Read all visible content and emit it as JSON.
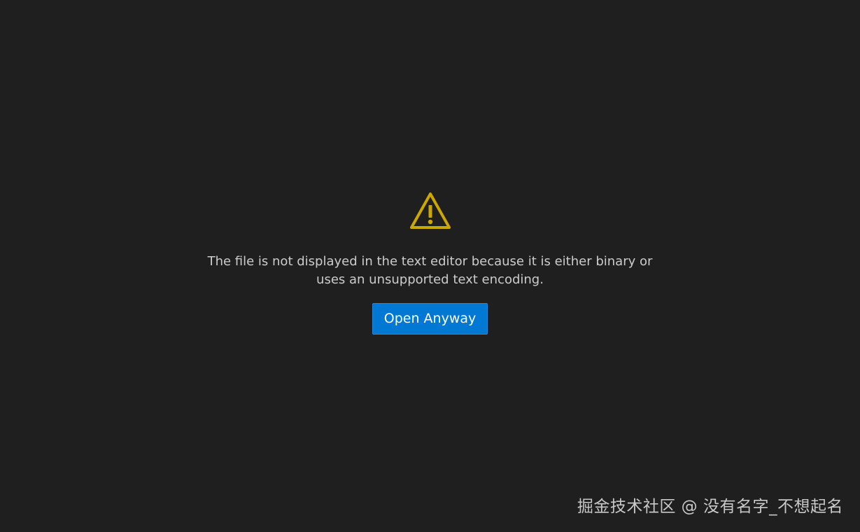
{
  "editor": {
    "message": "The file is not displayed in the text editor because it is either binary or uses an unsupported text encoding.",
    "open_button_label": "Open Anyway",
    "icon": "warning-icon"
  },
  "watermark": {
    "text": "掘金技术社区 @ 没有名字_不想起名"
  },
  "colors": {
    "background": "#1f1f1f",
    "text": "#cccccc",
    "warning": "#cca700",
    "button": "#0078d4"
  }
}
